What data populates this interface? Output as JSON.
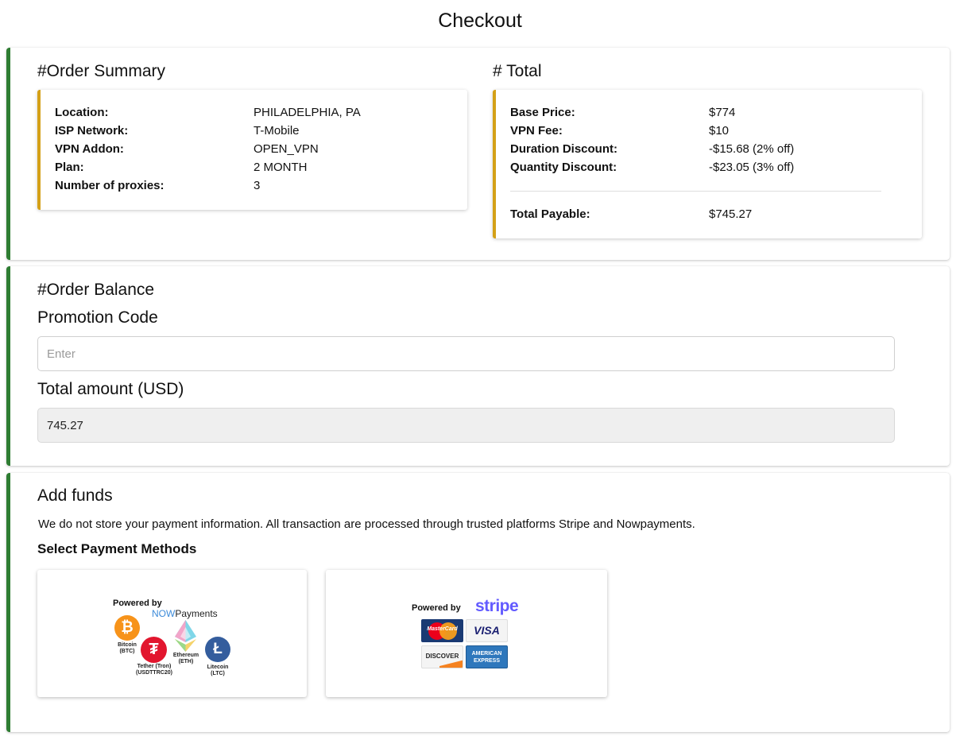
{
  "page": {
    "title": "Checkout"
  },
  "order_summary": {
    "heading": "#Order Summary",
    "rows": [
      {
        "label": "Location:",
        "value": "PHILADELPHIA, PA"
      },
      {
        "label": "ISP Network:",
        "value": "T-Mobile"
      },
      {
        "label": "VPN Addon:",
        "value": "OPEN_VPN"
      },
      {
        "label": "Plan:",
        "value": "2 MONTH"
      },
      {
        "label": "Number of proxies:",
        "value": "3"
      }
    ]
  },
  "total": {
    "heading": "# Total",
    "rows": [
      {
        "label": "Base Price:",
        "value": "$774"
      },
      {
        "label": "VPN Fee:",
        "value": "$10"
      },
      {
        "label": "Duration Discount:",
        "value": "-$15.68 (2% off)"
      },
      {
        "label": "Quantity Discount:",
        "value": "-$23.05 (3% off)"
      }
    ],
    "payable_label": "Total Payable:",
    "payable_value": "$745.27"
  },
  "order_balance": {
    "heading": "#Order Balance",
    "promo_label": "Promotion Code",
    "promo_placeholder": "Enter",
    "amount_label": "Total amount (USD)",
    "amount_value": "745.27"
  },
  "add_funds": {
    "heading": "Add funds",
    "note": "We do not store your payment information. All transaction are processed through trusted platforms Stripe and Nowpayments.",
    "methods_heading": "Select Payment Methods",
    "nowpayments": {
      "powered_by": "Powered by",
      "brand_now": "NOW",
      "brand_payments": "Payments",
      "coins": [
        {
          "name": "Bitcoin",
          "ticker": "(BTC)",
          "symbol": "₿",
          "color": "#f7931a"
        },
        {
          "name": "Tether (Tron)",
          "ticker": "(USDTTRC20)",
          "symbol": "₮",
          "color": "#e2162e"
        },
        {
          "name": "Ethereum",
          "ticker": "(ETH)",
          "symbol": "",
          "color": "#627eea"
        },
        {
          "name": "Litecoin",
          "ticker": "(LTC)",
          "symbol": "Ł",
          "color": "#345d9d"
        }
      ]
    },
    "stripe": {
      "powered_by": "Powered by",
      "brand": "stripe",
      "cards": [
        "MasterCard",
        "VISA",
        "DISCOVER",
        "AMERICAN EXPRESS"
      ]
    }
  },
  "colors": {
    "card_accent": "#2e7d32",
    "box_accent": "#d4a017",
    "stripe_brand": "#635bff",
    "nowpayments_brand": "#3d8bd9"
  }
}
